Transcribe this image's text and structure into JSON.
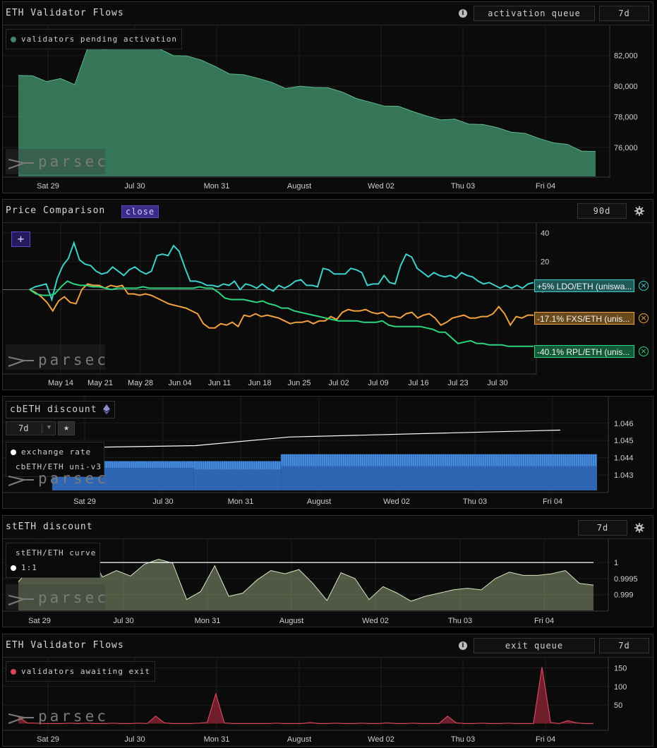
{
  "panels": {
    "p1": {
      "title": "ETH Validator Flows",
      "selector": "activation queue",
      "range": "7d",
      "legend": "validators pending activation",
      "watermark": "parsec"
    },
    "p2": {
      "title": "Price Comparison",
      "close_label": "close",
      "range": "90d",
      "add_label": "+",
      "watermark": "parsec",
      "pills": [
        {
          "label": "+5% LDO/ETH (uniswa...",
          "color": "#3dd0cc"
        },
        {
          "label": "-17.1% FXS/ETH (unis...",
          "color": "#f0a040"
        },
        {
          "label": "-40.1% RPL/ETH (unis...",
          "color": "#2bd67e"
        }
      ]
    },
    "p3": {
      "title": "cbETH discount",
      "range": "7d",
      "legend": [
        "exchange rate",
        "cbETH/ETH uni-v3"
      ],
      "watermark": "parsec"
    },
    "p4": {
      "title": "stETH discount",
      "range": "7d",
      "legend": [
        "stETH/ETH curve",
        "1:1"
      ],
      "watermark": "parsec"
    },
    "p5": {
      "title": "ETH Validator Flows",
      "selector": "exit queue",
      "range": "7d",
      "legend": "validators awaiting exit",
      "watermark": "parsec"
    }
  },
  "colors": {
    "activation": "#3d8a66",
    "ldo": "#3dd0cc",
    "fxs": "#f0a040",
    "rpl": "#2bd67e",
    "cbeth": "#3a7fd6",
    "steth": "#8c9a74",
    "exit": "#d9455a"
  },
  "chart_data": [
    {
      "type": "area",
      "title": "ETH Validator Flows",
      "series": [
        {
          "name": "validators pending activation",
          "values": [
            80700,
            80680,
            80300,
            80500,
            80100,
            82700,
            82400,
            82450,
            82950,
            82700,
            82450,
            82000,
            81970,
            81700,
            81280,
            80800,
            80750,
            80520,
            80250,
            79850,
            80000,
            79920,
            79900,
            79620,
            79200,
            78950,
            78700,
            78690,
            78350,
            78050,
            77800,
            77850,
            77520,
            77500,
            77300,
            77000,
            76920,
            76580,
            76300,
            76200,
            75760,
            75740
          ]
        }
      ],
      "x_ticks": [
        "Sat 29",
        "Jul 30",
        "Mon 31",
        "August",
        "Wed 02",
        "Thu 03",
        "Fri 04"
      ],
      "y_ticks": [
        76000,
        78000,
        80000,
        82000
      ],
      "ylim": [
        74200,
        83600
      ]
    },
    {
      "type": "line",
      "title": "Price Comparison",
      "series": [
        {
          "name": "+5% LDO/ETH (uniswa...",
          "values": [
            0,
            2,
            3,
            4,
            -7,
            8,
            17,
            22,
            33,
            21,
            18,
            17,
            13,
            11,
            12,
            16,
            13,
            10,
            14,
            16,
            13,
            11,
            13,
            24,
            25,
            24,
            31,
            27,
            16,
            6,
            6,
            5,
            3,
            3,
            2,
            4,
            3,
            6,
            0,
            4,
            3,
            1,
            4,
            1,
            -1,
            3,
            1,
            3,
            6,
            7,
            3,
            3,
            2,
            15,
            14,
            11,
            11,
            11,
            15,
            14,
            12,
            3,
            4,
            4,
            10,
            5,
            4,
            17,
            25,
            23,
            15,
            12,
            9,
            12,
            10,
            9,
            10,
            8,
            12,
            10,
            9,
            6,
            4,
            5,
            3,
            1,
            3,
            1,
            3,
            1,
            4,
            5
          ]
        },
        {
          "name": "-17.1% FXS/ETH (unis...",
          "values": [
            0,
            -2,
            -5,
            -9,
            -15,
            -8,
            -5,
            -9,
            -10,
            0,
            4,
            3,
            3,
            1,
            3,
            2,
            3,
            -3,
            -3,
            -4,
            -3,
            -4,
            -6,
            -8,
            -10,
            -11,
            -12,
            -13,
            -15,
            -17,
            -24,
            -27,
            -27,
            -24,
            -25,
            -23,
            -26,
            -18,
            -19,
            -17,
            -19,
            -18,
            -19,
            -20,
            -22,
            -24,
            -23,
            -23,
            -22,
            -24,
            -22,
            -22,
            -19,
            -21,
            -16,
            -14,
            -15,
            -15,
            -14,
            -16,
            -17,
            -16,
            -19,
            -19,
            -20,
            -17,
            -16,
            -20,
            -18,
            -17,
            -20,
            -25,
            -23,
            -20,
            -19,
            -18,
            -20,
            -20,
            -19,
            -19,
            -17,
            -12,
            -17,
            -25,
            -19,
            -20,
            -18,
            -18
          ]
        },
        {
          "name": "-40.1% RPL/ETH (unis...",
          "values": [
            0,
            -3,
            -4,
            -4,
            -3,
            2,
            6,
            4,
            3,
            3,
            2,
            2,
            1,
            0,
            1,
            1,
            1,
            1,
            2,
            1,
            1,
            1,
            1,
            1,
            1,
            1,
            1,
            2,
            1,
            1,
            -2,
            -6,
            -7,
            -7,
            -7,
            -8,
            -9,
            -8,
            -10,
            -11,
            -13,
            -13,
            -15,
            -16,
            -17,
            -18,
            -19,
            -20,
            -21,
            -22,
            -22,
            -22,
            -22,
            -23,
            -23,
            -23,
            -22,
            -25,
            -26,
            -26,
            -26,
            -26,
            -26,
            -27,
            -28,
            -30,
            -30,
            -34,
            -38,
            -37,
            -36,
            -38,
            -38,
            -39,
            -39,
            -39,
            -40,
            -40,
            -40,
            -40,
            -40
          ]
        }
      ],
      "x_ticks": [
        "May 14",
        "May 21",
        "May 28",
        "Jun 04",
        "Jun 11",
        "Jun 18",
        "Jun 25",
        "Jul 02",
        "Jul 09",
        "Jul 16",
        "Jul 23",
        "Jul 30"
      ],
      "y_ticks": [
        0,
        20,
        40
      ],
      "ylim": [
        -55,
        45
      ]
    },
    {
      "type": "bar",
      "title": "cbETH discount",
      "series": [
        {
          "name": "exchange rate",
          "x": [
            0,
            0.22,
            0.42,
            1
          ],
          "values": [
            1.0446,
            1.0447,
            1.0452,
            1.0456
          ]
        },
        {
          "name": "cbETH/ETH uni-v3",
          "band": [
            [
              0,
              0.26,
              1.0438,
              1.0434
            ],
            [
              0.26,
              0.42,
              1.0438,
              1.0433
            ],
            [
              0.42,
              1,
              1.0442,
              1.0435
            ]
          ]
        }
      ],
      "x_ticks": [
        "Sat 29",
        "Jul 30",
        "Mon 31",
        "August",
        "Wed 02",
        "Thu 03",
        "Fri 04"
      ],
      "y_ticks": [
        1.043,
        1.044,
        1.045,
        1.046
      ],
      "ylim": [
        1.0421,
        1.0473
      ]
    },
    {
      "type": "area",
      "title": "stETH discount",
      "series": [
        {
          "name": "stETH/ETH curve",
          "values": [
            0.9994,
            0.9999,
            0.9998,
            0.9996,
            1.0005,
            1.0003,
            0.99955,
            0.99975,
            0.99958,
            0.99995,
            1.0001,
            0.99998,
            0.99885,
            0.9991,
            0.9999,
            0.99895,
            0.99905,
            0.99945,
            0.99975,
            0.99965,
            0.99978,
            0.99935,
            0.99882,
            0.99968,
            0.9995,
            0.99885,
            0.99925,
            0.99905,
            0.9988,
            0.99895,
            0.99905,
            0.99915,
            0.9992,
            0.99915,
            0.9995,
            0.9997,
            0.9996,
            0.9996,
            0.99965,
            0.99975,
            0.99935,
            0.9993
          ]
        },
        {
          "name": "1:1",
          "values": [
            1,
            1
          ]
        }
      ],
      "x_ticks": [
        "Sat 29",
        "Jul 30",
        "Mon 31",
        "August",
        "Wed 02",
        "Thu 03",
        "Fri 04"
      ],
      "y_ticks": [
        0.999,
        0.9995,
        1
      ],
      "ylim": [
        0.9986,
        1.00055
      ]
    },
    {
      "type": "area",
      "title": "ETH Validator Flows",
      "series": [
        {
          "name": "validators awaiting exit",
          "values": [
            18,
            2,
            1,
            0,
            0,
            0,
            1,
            0,
            1,
            0,
            0,
            1,
            0,
            0,
            1,
            0,
            20,
            2,
            0,
            0,
            0,
            1,
            3,
            80,
            2,
            0,
            0,
            0,
            0,
            0,
            1,
            0,
            0,
            0,
            3,
            0,
            0,
            1,
            0,
            0,
            1,
            0,
            0,
            2,
            0,
            0,
            1,
            0,
            0,
            0,
            20,
            2,
            0,
            0,
            1,
            0,
            0,
            1,
            0,
            0,
            0,
            152,
            3,
            0,
            8,
            2,
            0,
            0
          ]
        }
      ],
      "x_ticks": [
        "Sat 29",
        "Jul 30",
        "Mon 31",
        "August",
        "Wed 02",
        "Thu 03",
        "Fri 04"
      ],
      "y_ticks": [
        50,
        100,
        150
      ],
      "ylim": [
        -5,
        170
      ]
    }
  ]
}
